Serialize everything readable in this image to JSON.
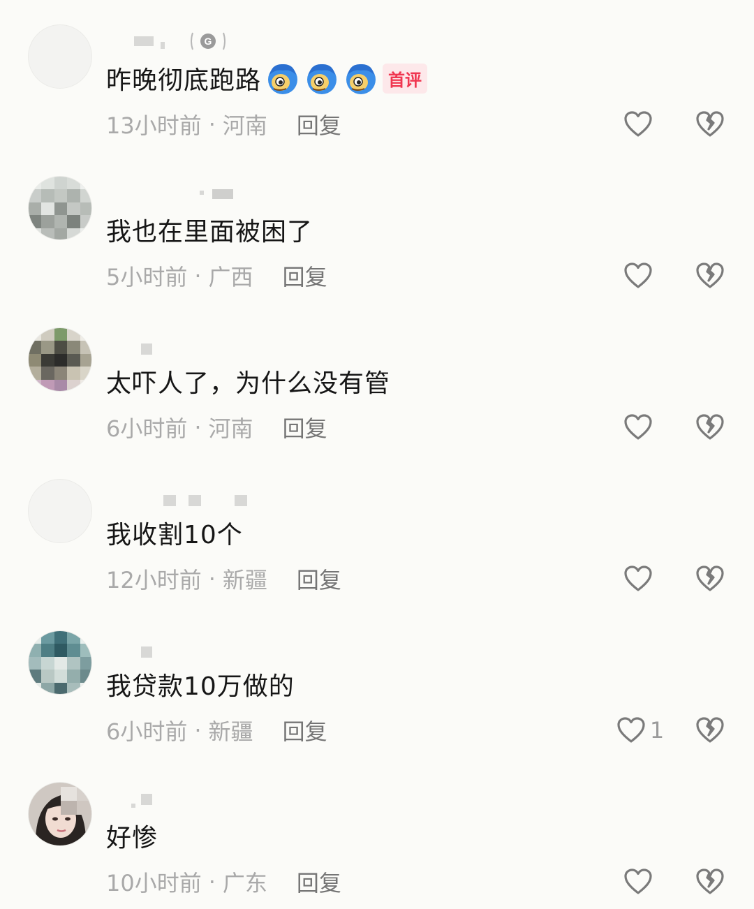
{
  "comments": [
    {
      "text": "昨晚彻底跑路",
      "emoji_count": 3,
      "emoji": "blue-hair-face-emoji",
      "badge": "首评",
      "time": "13小时前",
      "location": "河南",
      "reply": "回复",
      "likes": ""
    },
    {
      "text": "我也在里面被困了",
      "time": "5小时前",
      "location": "广西",
      "reply": "回复",
      "likes": ""
    },
    {
      "text": "太吓人了，为什么没有管",
      "time": "6小时前",
      "location": "河南",
      "reply": "回复",
      "likes": ""
    },
    {
      "text": "我收割10个",
      "time": "12小时前",
      "location": "新疆",
      "reply": "回复",
      "likes": ""
    },
    {
      "text": "我贷款10万做的",
      "time": "6小时前",
      "location": "新疆",
      "reply": "回复",
      "likes": "1"
    },
    {
      "text": "好惨",
      "time": "10小时前",
      "location": "广东",
      "reply": "回复",
      "likes": ""
    }
  ],
  "separator": "·",
  "icons": {
    "like": "heart-outline-icon",
    "dislike": "broken-heart-icon",
    "badge": "g-badge-icon"
  },
  "colors": {
    "background": "#fbfbf8",
    "text": "#161616",
    "meta": "#a9a9a9",
    "reply": "#757575",
    "badge_bg": "#fde8ea",
    "badge_text": "#f03650"
  }
}
